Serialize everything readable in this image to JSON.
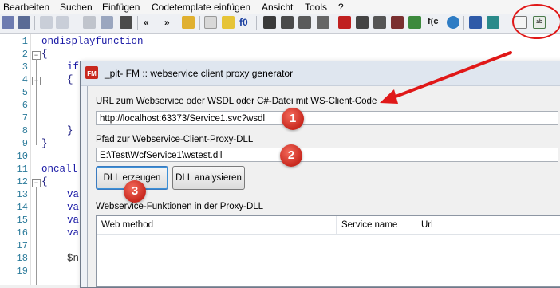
{
  "menu": [
    "Bearbeiten",
    "Suchen",
    "Einfügen",
    "Codetemplate einfügen",
    "Ansicht",
    "Tools",
    "?"
  ],
  "toolbar": {
    "nav_back": "«",
    "nav_forward": "»",
    "f0": "f0",
    "fc": "f(c",
    "ab": "ab"
  },
  "editor": {
    "line_numbers": [
      "1",
      "2",
      "3",
      "4",
      "5",
      "6",
      "7",
      "8",
      "9",
      "10",
      "11",
      "12",
      "13",
      "14",
      "15",
      "16",
      "17",
      "18",
      "19"
    ],
    "line1": "ondisplayfunction",
    "brace_open": "{",
    "brace_close": "}",
    "line3": "if",
    "line11": "oncall",
    "va": "va",
    "line18": "$n"
  },
  "dialog": {
    "title": "_pit- FM :: webservice client proxy generator",
    "app_icon_text": "FM",
    "url_label": "URL zum Webservice oder WSDL oder C#-Datei mit WS-Client-Code",
    "url_value": "http://localhost:63373/Service1.svc?wsdl",
    "path_label": "Pfad zur Webservice-Client-Proxy-DLL",
    "path_value": "E:\\Test\\WcfService1\\wstest.dll",
    "generate_button": "DLL erzeugen",
    "analyze_button": "DLL analysieren",
    "functions_label": "Webservice-Funktionen in der Proxy-DLL",
    "columns": [
      "Web method",
      "Service name",
      "Url"
    ]
  },
  "annotations": {
    "badges": [
      "1",
      "2",
      "3"
    ],
    "accent": "#e01818"
  }
}
